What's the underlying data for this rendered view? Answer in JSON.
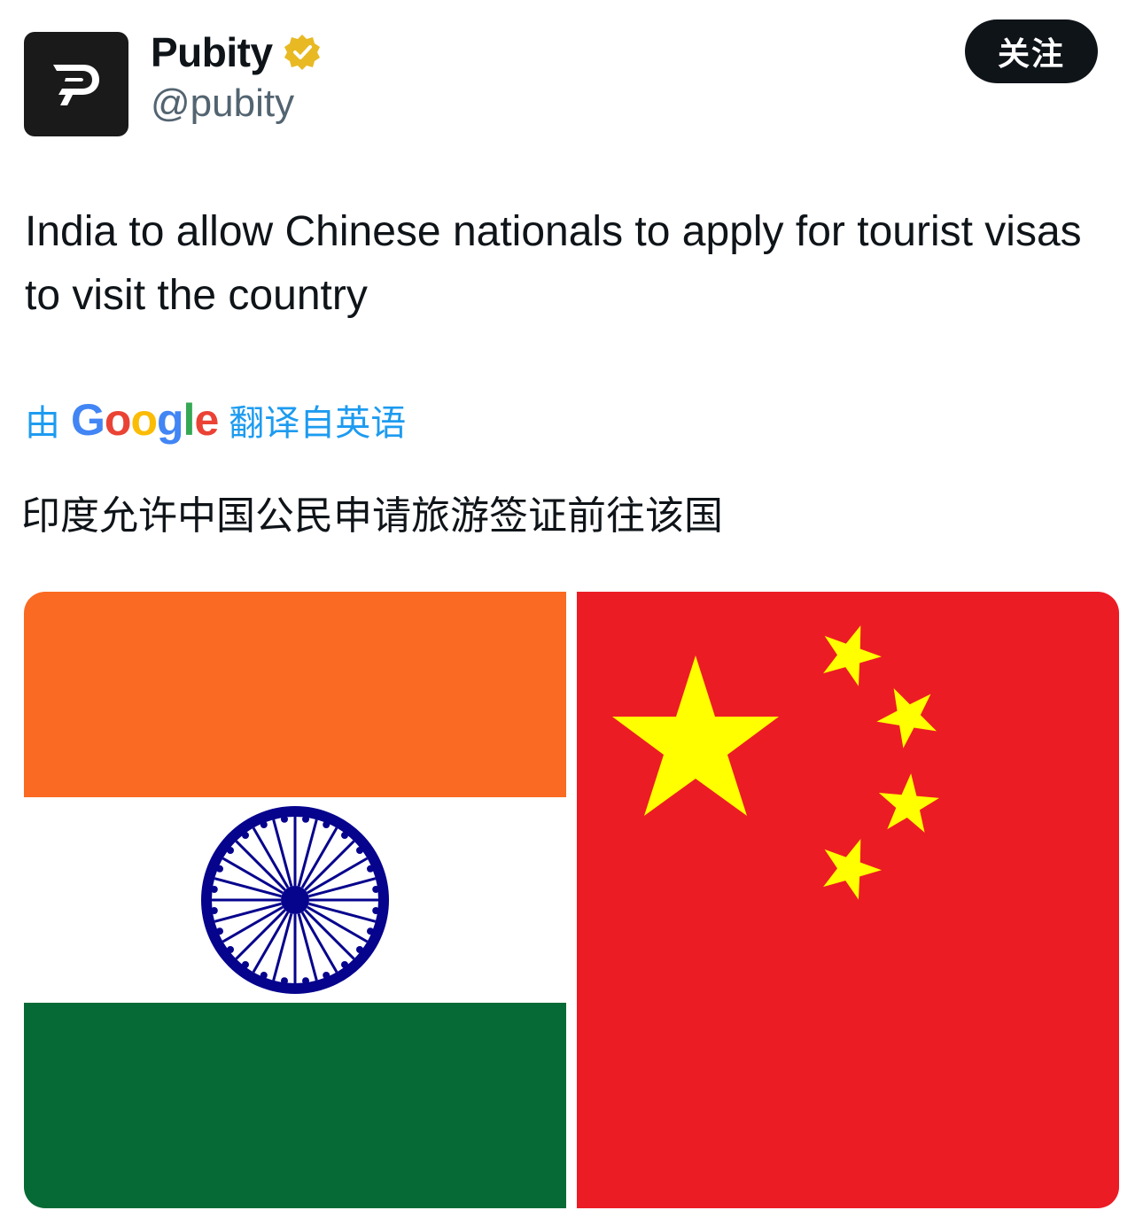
{
  "author": {
    "display_name": "Pubity",
    "handle": "@pubity",
    "verified_badge_icon": "verified-gold-badge-icon",
    "avatar_icon": "pubity-logo-icon"
  },
  "follow_button": {
    "label": "关注"
  },
  "tweet": {
    "text": "India to allow Chinese nationals to apply for tourist visas to visit the country"
  },
  "translation": {
    "prefix": "由",
    "provider": "Google",
    "suffix": "翻译自英语",
    "text": "印度允许中国公民申请旅游签证前往该国"
  },
  "media": {
    "images": [
      {
        "name": "india-flag",
        "colors": [
          "#fa6a22",
          "#ffffff",
          "#066a36",
          "#06038d"
        ]
      },
      {
        "name": "china-flag",
        "colors": [
          "#ec1c24",
          "#ffff00"
        ]
      }
    ]
  }
}
